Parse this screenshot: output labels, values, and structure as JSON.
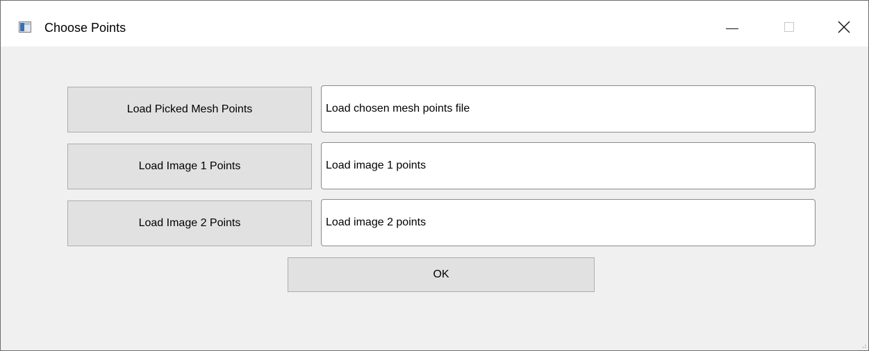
{
  "window": {
    "title": "Choose Points",
    "icon": "app-window-icon",
    "controls": [
      "minimize-icon",
      "maximize-icon",
      "close-icon"
    ]
  },
  "rows": [
    {
      "button_label": "Load Picked Mesh Points",
      "field_value": "Load chosen mesh points file"
    },
    {
      "button_label": "Load Image 1 Points",
      "field_value": "Load image 1 points"
    },
    {
      "button_label": "Load Image 2 Points",
      "field_value": "Load image 2 points"
    }
  ],
  "ok_label": "OK",
  "colors": {
    "dialog_background": "#f0f0f0",
    "button_face": "#e1e1e1",
    "button_border": "#adadad",
    "field_border": "#8a8a8a"
  }
}
